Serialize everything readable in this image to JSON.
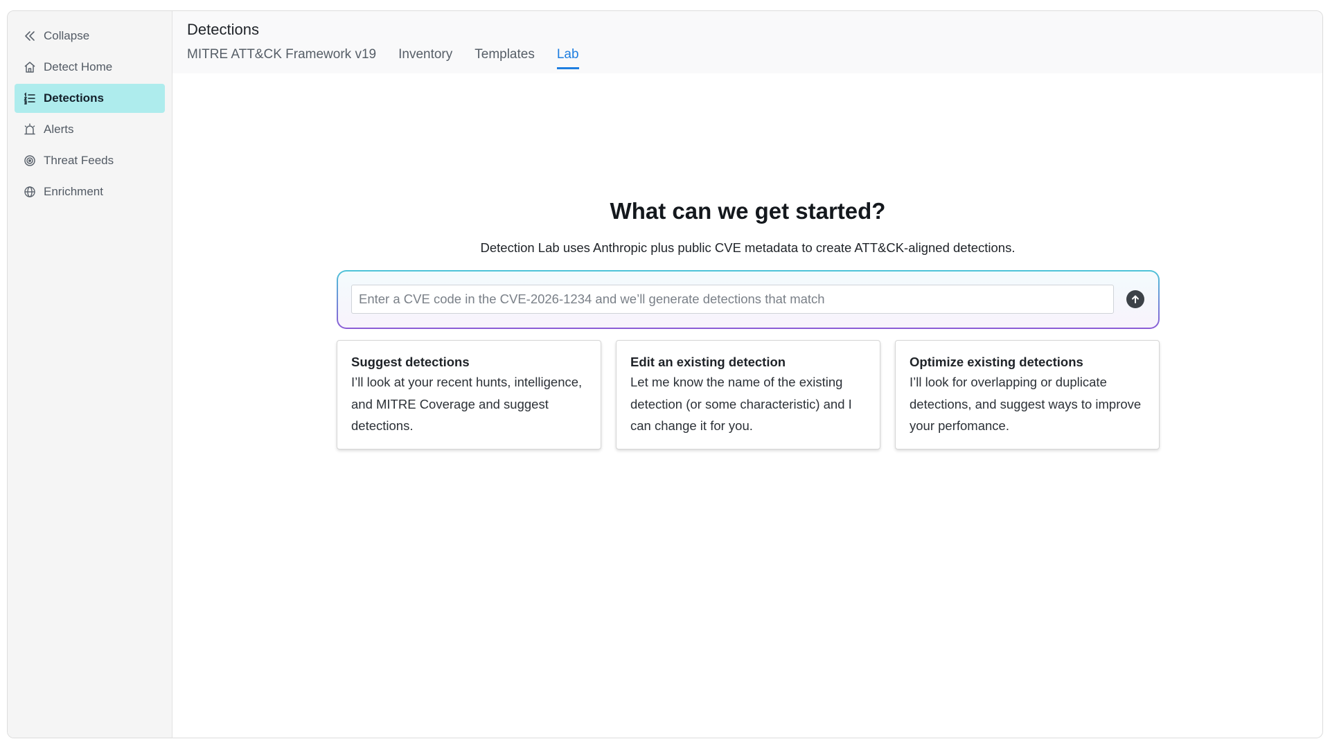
{
  "sidebar": {
    "items": [
      {
        "label": "Collapse",
        "icon": "chevrons-left-icon"
      },
      {
        "label": "Detect Home",
        "icon": "home-icon"
      },
      {
        "label": "Detections",
        "icon": "list-icon",
        "active": true
      },
      {
        "label": "Alerts",
        "icon": "siren-icon"
      },
      {
        "label": "Threat Feeds",
        "icon": "target-icon"
      },
      {
        "label": "Enrichment",
        "icon": "globe-icon"
      }
    ]
  },
  "header": {
    "title": "Detections",
    "tabs": [
      {
        "label": "MITRE ATT&CK Framework v19"
      },
      {
        "label": "Inventory"
      },
      {
        "label": "Templates"
      },
      {
        "label": "Lab",
        "active": true
      }
    ]
  },
  "hero": {
    "title": "What can we get started?",
    "subtitle": "Detection Lab uses Anthropic plus public CVE metadata to create ATT&CK-aligned detections."
  },
  "prompt": {
    "value": "",
    "placeholder": "Enter a CVE code in the CVE-2026-1234 and we’ll generate detections that match",
    "send_icon": "arrow-up-icon"
  },
  "cards": [
    {
      "title": "Suggest detections",
      "body": "I’ll look at your recent hunts, intelligence, and MITRE Coverage and suggest detections."
    },
    {
      "title": "Edit an existing detection",
      "body": "Let me know the name of the existing detection (or some characteristic) and I can change it for you."
    },
    {
      "title": "Optimize existing detections",
      "body": "I’ll look for overlapping or duplicate detections, and suggest ways to improve your perfomance."
    }
  ],
  "colors": {
    "accent": "#1f7ee0",
    "active_nav_bg": "#aeeced",
    "gradient_start": "#4ec4d8",
    "gradient_end": "#8c5bd6"
  }
}
